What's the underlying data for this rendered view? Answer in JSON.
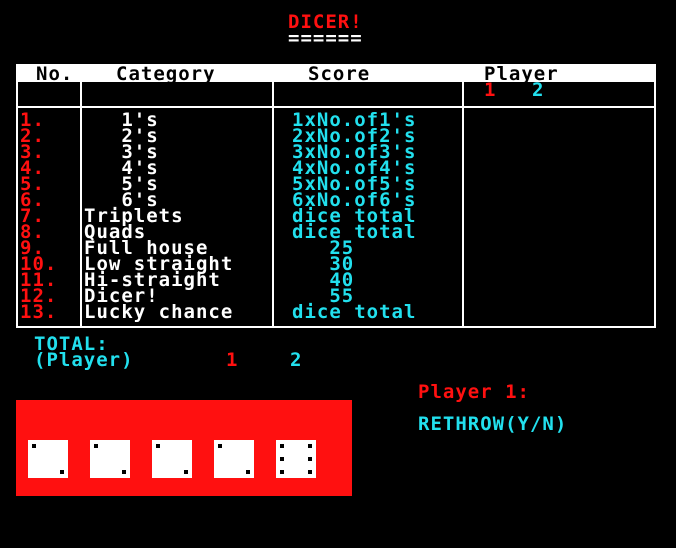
{
  "title": "DICER!",
  "title_underline": "======",
  "scoresheet": {
    "headers": {
      "no": "No.",
      "category": "Category",
      "score": "Score",
      "player": "Player"
    },
    "player_numbers": [
      "1",
      "2"
    ],
    "rows": [
      {
        "no": "1.",
        "category": "   1's",
        "score": "1xNo.of1's"
      },
      {
        "no": "2.",
        "category": "   2's",
        "score": "2xNo.of2's"
      },
      {
        "no": "3.",
        "category": "   3's",
        "score": "3xNo.of3's"
      },
      {
        "no": "4.",
        "category": "   4's",
        "score": "4xNo.of4's"
      },
      {
        "no": "5.",
        "category": "   5's",
        "score": "5xNo.of5's"
      },
      {
        "no": "6.",
        "category": "   6's",
        "score": "6xNo.of6's"
      },
      {
        "no": "7.",
        "category": "Triplets",
        "score": "dice total"
      },
      {
        "no": "8.",
        "category": "Quads",
        "score": "dice total"
      },
      {
        "no": "9.",
        "category": "Full house",
        "score": "   25"
      },
      {
        "no": "10.",
        "category": "Low straight",
        "score": "   30"
      },
      {
        "no": "11.",
        "category": "Hi-straight",
        "score": "   40"
      },
      {
        "no": "12.",
        "category": "Dicer!",
        "score": "   55"
      },
      {
        "no": "13.",
        "category": "Lucky chance",
        "score": "dice total"
      }
    ]
  },
  "totals": {
    "label": "TOTAL:",
    "sublabel": "(Player)",
    "player1": "1",
    "player2": "2"
  },
  "status": {
    "current_player": "Player 1:",
    "prompt": "RETHROW(Y/N)"
  },
  "dice": [
    2,
    2,
    2,
    2,
    6
  ],
  "colors": {
    "background": "#000000",
    "accent_red": "#ff1010",
    "accent_cyan": "#22e0ee",
    "text_white": "#ffffff"
  }
}
